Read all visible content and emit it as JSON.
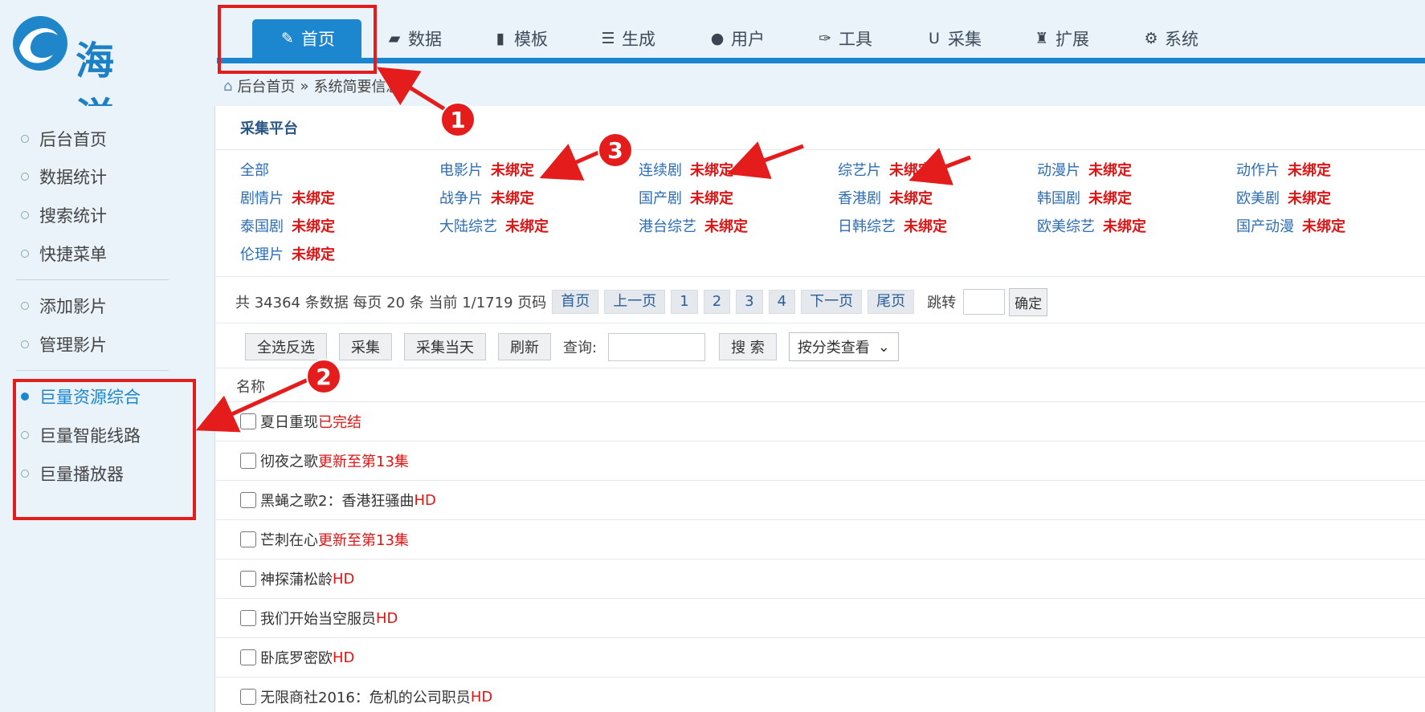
{
  "brand": {
    "name": "海洋",
    "accent": "#1c87cf"
  },
  "nav": {
    "items": [
      {
        "label": "首页",
        "icon": "edit-icon"
      },
      {
        "label": "数据",
        "icon": "book-icon"
      },
      {
        "label": "模板",
        "icon": "file-icon"
      },
      {
        "label": "生成",
        "icon": "database-icon"
      },
      {
        "label": "用户",
        "icon": "user-icon"
      },
      {
        "label": "工具",
        "icon": "wrench-icon"
      },
      {
        "label": "采集",
        "icon": "magnet-icon"
      },
      {
        "label": "扩展",
        "icon": "puzzle-icon"
      },
      {
        "label": "系统",
        "icon": "gear-icon"
      }
    ],
    "active": "首页"
  },
  "breadcrumb": {
    "home": "后台首页",
    "sep": "»",
    "current": "系统简要信息"
  },
  "sidebar": {
    "items": [
      {
        "label": "后台首页"
      },
      {
        "label": "数据统计"
      },
      {
        "label": "搜索统计"
      },
      {
        "label": "快捷菜单"
      },
      {
        "label": "添加影片"
      },
      {
        "label": "管理影片"
      },
      {
        "label": "巨量资源综合"
      },
      {
        "label": "巨量智能线路"
      },
      {
        "label": "巨量播放器"
      }
    ],
    "active": "巨量资源综合"
  },
  "platform": {
    "title": "采集平台",
    "status_color": "#e01515",
    "items": [
      {
        "name": "全部",
        "status": ""
      },
      {
        "name": "电影片",
        "status": "未绑定"
      },
      {
        "name": "连续剧",
        "status": "未绑定"
      },
      {
        "name": "综艺片",
        "status": "未绑定"
      },
      {
        "name": "动漫片",
        "status": "未绑定"
      },
      {
        "name": "动作片",
        "status": "未绑定"
      },
      {
        "name": "剧情片",
        "status": "未绑定"
      },
      {
        "name": "战争片",
        "status": "未绑定"
      },
      {
        "name": "国产剧",
        "status": "未绑定"
      },
      {
        "name": "香港剧",
        "status": "未绑定"
      },
      {
        "name": "韩国剧",
        "status": "未绑定"
      },
      {
        "name": "欧美剧",
        "status": "未绑定"
      },
      {
        "name": "泰国剧",
        "status": "未绑定"
      },
      {
        "name": "大陆综艺",
        "status": "未绑定"
      },
      {
        "name": "港台综艺",
        "status": "未绑定"
      },
      {
        "name": "日韩综艺",
        "status": "未绑定"
      },
      {
        "name": "欧美综艺",
        "status": "未绑定"
      },
      {
        "name": "国产动漫",
        "status": "未绑定"
      },
      {
        "name": "伦理片",
        "status": "未绑定"
      }
    ]
  },
  "pager": {
    "summary": "共 34364 条数据 每页 20 条 当前 1/1719 页码",
    "first": "首页",
    "prev": "上一页",
    "pages": [
      "1",
      "2",
      "3",
      "4"
    ],
    "next": "下一页",
    "last": "尾页",
    "jump_label": "跳转",
    "confirm": "确定"
  },
  "toolbar": {
    "select_all": "全选反选",
    "collect": "采集",
    "collect_today": "采集当天",
    "refresh": "刷新",
    "query_label": "查询:",
    "search": "搜 索",
    "category_select": "按分类查看"
  },
  "list": {
    "header": "名称",
    "rows": [
      {
        "title": "夏日重现",
        "status": "已完结"
      },
      {
        "title": "彻夜之歌",
        "status": "更新至第13集"
      },
      {
        "title": "黑蝇之歌2：香港狂骚曲",
        "status": "HD"
      },
      {
        "title": "芒刺在心",
        "status": "更新至第13集"
      },
      {
        "title": "神探蒲松龄",
        "status": "HD"
      },
      {
        "title": "我们开始当空服员",
        "status": "HD"
      },
      {
        "title": "卧底罗密欧",
        "status": "HD"
      },
      {
        "title": "无限商社2016：危机的公司职员",
        "status": "HD"
      }
    ]
  },
  "annotations": {
    "color": "#e41c1c",
    "labels": [
      "1",
      "2",
      "3"
    ]
  }
}
